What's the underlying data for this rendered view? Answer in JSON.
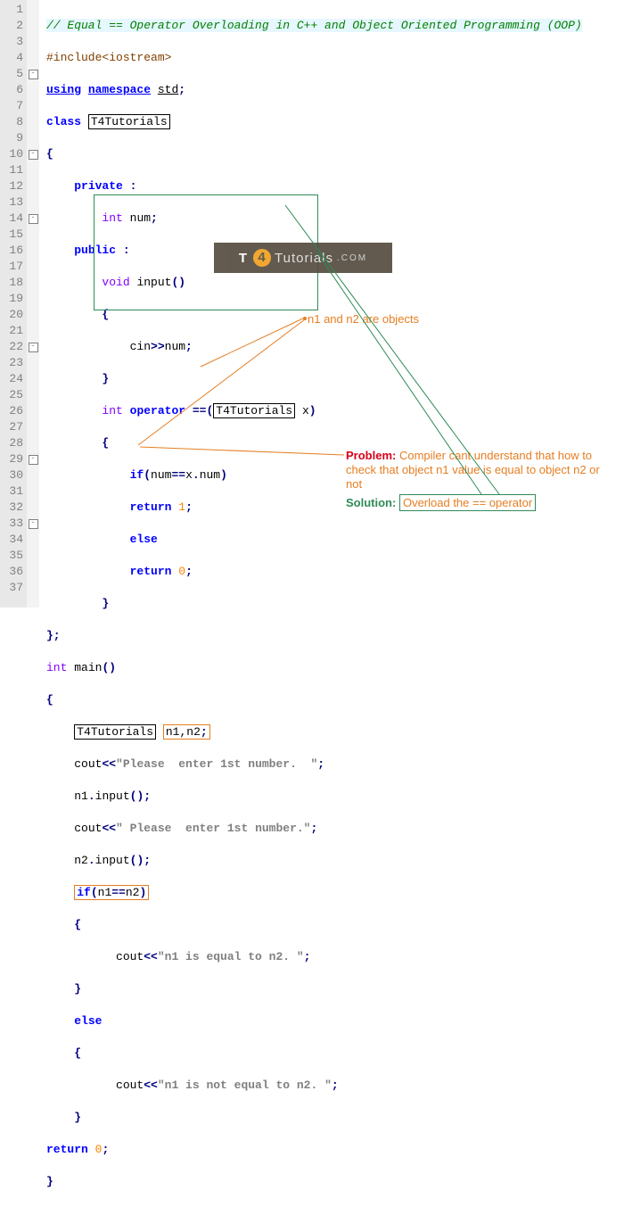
{
  "lineNumbers": [
    "1",
    "2",
    "3",
    "4",
    "5",
    "6",
    "7",
    "8",
    "9",
    "10",
    "11",
    "12",
    "13",
    "14",
    "15",
    "16",
    "17",
    "18",
    "19",
    "20",
    "21",
    "22",
    "23",
    "24",
    "25",
    "26",
    "27",
    "28",
    "29",
    "30",
    "31",
    "32",
    "33",
    "34",
    "35",
    "36",
    "37"
  ],
  "foldMarks": {
    "5": "⊟",
    "10": "⊟",
    "14": "⊟",
    "22": "⊟",
    "29": "⊟",
    "33": "⊟"
  },
  "code": {
    "l1_comment": "// Equal == Operator Overloading in C++ and Object Oriented Programming (OOP)",
    "l2_include": "#include<iostream>",
    "l3_using": "using",
    "l3_namespace": "namespace",
    "l3_std": "std",
    "l4_class": "class",
    "l4_name": "T4Tutorials",
    "l6_private": "private",
    "l7_int": "int",
    "l7_num": "num",
    "l8_public": "public",
    "l9_void": "void",
    "l9_input": "input",
    "l11_cin": "cin",
    "l11_num": "num",
    "l13_int": "int",
    "l13_operator": "operator",
    "l13_eqeq": "==",
    "l13_type": "T4Tutorials",
    "l13_x": "x",
    "l15_if": "if",
    "l15_num": "num",
    "l15_eqeq": "==",
    "l15_xnum": "x",
    "l15_dot": ".",
    "l15_num2": "num",
    "l16_return": "return",
    "l16_val": "1",
    "l17_else": "else",
    "l18_return": "return",
    "l18_val": "0",
    "l21_int": "int",
    "l21_main": "main",
    "l23_type": "T4Tutorials",
    "l23_vars": "n1,n2",
    "l24_cout": "cout",
    "l24_str": "\"Please  enter 1st number.  \"",
    "l25_n1": "n1",
    "l25_input": "input",
    "l26_cout": "cout",
    "l26_str": "\" Please  enter 1st number.\"",
    "l27_n2": "n2",
    "l27_input": "input",
    "l28_if": "if",
    "l28_n1": "n1",
    "l28_eqeq": "==",
    "l28_n2": "n2",
    "l30_cout": "cout",
    "l30_str": "\"n1 is equal to n2. \"",
    "l32_else": "else",
    "l34_cout": "cout",
    "l34_str": "\"n1 is not equal to n2. \"",
    "l36_return": "return",
    "l36_val": "0"
  },
  "annotations": {
    "objects_label": "n1 and n2 are objects",
    "problem_label": "Problem:",
    "problem_text": "Compiler cant understand that how to check that object n1 value is equal to object n2 or not",
    "solution_label": "Solution:",
    "solution_text": "Overload the == operator"
  },
  "watermark": {
    "t": "T",
    "four": "4",
    "tutorials": "Tutorials",
    "com": ".COM"
  }
}
